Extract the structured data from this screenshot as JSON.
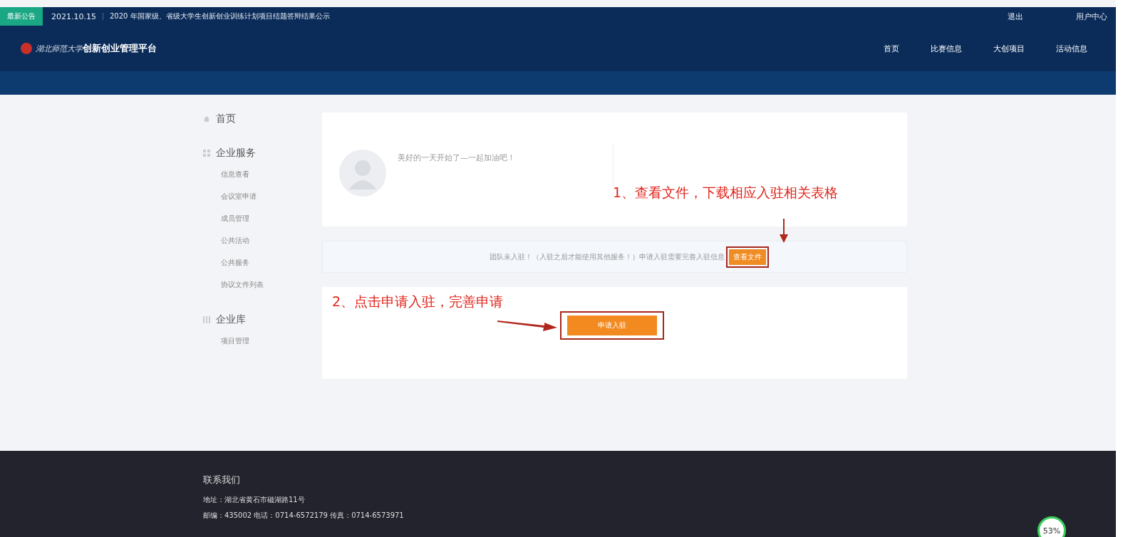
{
  "notice_bar": {
    "badge": "最新公告",
    "date": "2021.10.15",
    "text": "2020 年国家级、省级大学生创新创业训练计划项目结题答辩结果公示",
    "links": [
      "退出",
      "用户中心"
    ]
  },
  "header": {
    "logo_school": "湖北师范大学",
    "logo_title": "创新创业管理平台",
    "nav": [
      {
        "label": "首页"
      },
      {
        "label": "比赛信息"
      },
      {
        "label": "大创项目"
      },
      {
        "label": "活动信息"
      }
    ]
  },
  "sidebar": [
    {
      "label": "首页"
    },
    {
      "label": "企业服务",
      "children": [
        {
          "label": "信息查看"
        },
        {
          "label": "会议室申请"
        },
        {
          "label": "成员管理"
        },
        {
          "label": "公共活动"
        },
        {
          "label": "公共服务"
        },
        {
          "label": "协议文件列表"
        }
      ]
    },
    {
      "label": "企业库",
      "children": [
        {
          "label": "项目管理"
        }
      ]
    }
  ],
  "profile": {
    "greeting": "美好的一天开始了—一起加油吧！"
  },
  "annotations": [
    "1、查看文件，下载相应入驻相关表格",
    "2、点击申请入驻，完善申请"
  ],
  "notice": {
    "text": "团队未入驻！（入驻之后才能使用其他服务！）申请入驻需要完善入驻信息",
    "button": "查看文件"
  },
  "apply_button": "申请入驻",
  "footer": {
    "title": "联系我们",
    "lines": [
      "地址：湖北省黄石市磁湖路11号",
      "邮编：435002 电话：0714-6572179 传真：0714-6573971"
    ]
  },
  "speed_badge": {
    "value": "53%"
  }
}
